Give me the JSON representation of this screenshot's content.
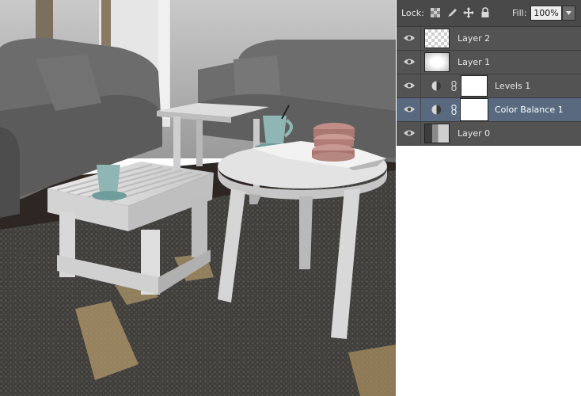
{
  "document": {
    "scene_description_icon": "rendered-living-room-image"
  },
  "layers_panel": {
    "lock_label": "Lock:",
    "lock_icons": [
      "lock-transparent-pixels-icon",
      "lock-image-pixels-icon",
      "lock-position-icon",
      "lock-all-icon"
    ],
    "fill_label": "Fill:",
    "fill_value": "100%",
    "layers": [
      {
        "name": "Layer 2",
        "kind": "pixel",
        "thumb": "checker",
        "visible": true,
        "selected": false
      },
      {
        "name": "Layer 1",
        "kind": "pixel",
        "thumb": "glow",
        "visible": true,
        "selected": false
      },
      {
        "name": "Levels 1",
        "kind": "adjustment",
        "visible": true,
        "selected": false
      },
      {
        "name": "Color Balance 1",
        "kind": "adjustment",
        "visible": true,
        "selected": true
      },
      {
        "name": "Layer 0",
        "kind": "pixel",
        "thumb": "photo",
        "visible": true,
        "selected": false
      }
    ],
    "colors": {
      "panel_bg": "#535353",
      "selected_row": "#586980",
      "lock_bar": "#494949"
    }
  }
}
